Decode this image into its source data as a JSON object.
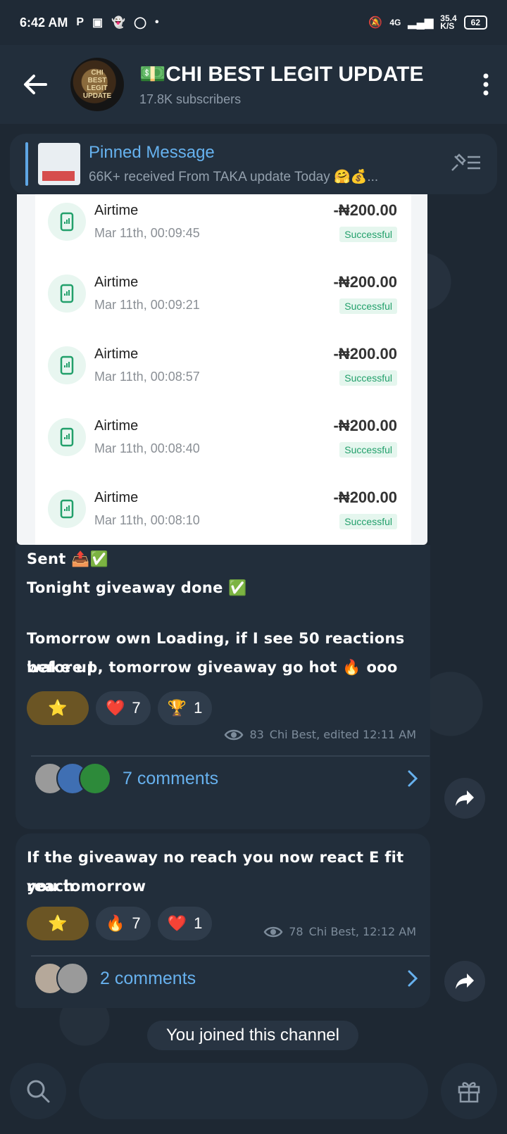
{
  "status_bar": {
    "time": "6:42 AM",
    "notif_icons": [
      "P",
      "screenshot-icon",
      "snapchat-icon",
      "whatsapp-icon",
      "dot-icon"
    ],
    "net": "4G",
    "speed": "35.4",
    "speed_unit": "K/S",
    "battery": "62"
  },
  "header": {
    "title": "💵CHI BEST LEGIT UPDATE",
    "subscribers": "17.8K subscribers",
    "avatar_text": "CHI BEST LEGIT UPDATE"
  },
  "pinned": {
    "title": "Pinned Message",
    "body": "66K+ received From TAKA update Today 🤗💰..."
  },
  "transactions": [
    {
      "name": "Airtime",
      "date": "Mar 11th, 00:09:45",
      "amount": "-₦200.00",
      "status": "Successful"
    },
    {
      "name": "Airtime",
      "date": "Mar 11th, 00:09:21",
      "amount": "-₦200.00",
      "status": "Successful"
    },
    {
      "name": "Airtime",
      "date": "Mar 11th, 00:08:57",
      "amount": "-₦200.00",
      "status": "Successful"
    },
    {
      "name": "Airtime",
      "date": "Mar 11th, 00:08:40",
      "amount": "-₦200.00",
      "status": "Successful"
    },
    {
      "name": "Airtime",
      "date": "Mar 11th, 00:08:10",
      "amount": "-₦200.00",
      "status": "Successful"
    }
  ],
  "message1": {
    "line1": "Sent 📤✅",
    "line2": "Tonight giveaway done ✅",
    "line3": "Tomorrow own Loading, if I see 50 reactions before I",
    "line4": "wake up, tomorrow giveaway go hot 🔥 ooo",
    "reactions": [
      {
        "emoji": "⭐",
        "count": ""
      },
      {
        "emoji": "❤️",
        "count": "7"
      },
      {
        "emoji": "🏆",
        "count": "1"
      }
    ],
    "views": "83",
    "meta": "Chi Best, edited 12:11 AM",
    "comments": "7 comments"
  },
  "message2": {
    "line1": "If the giveaway no reach you now react E fit reach",
    "line2": "you tomorrow",
    "reactions": [
      {
        "emoji": "⭐",
        "count": ""
      },
      {
        "emoji": "🔥",
        "count": "7"
      },
      {
        "emoji": "❤️",
        "count": "1"
      }
    ],
    "views": "78",
    "meta": "Chi Best, 12:12 AM",
    "comments": "2 comments"
  },
  "joined_notice": "You joined this channel",
  "colors": {
    "accent": "#66b2ef",
    "success": "#22a06b",
    "bubble": "#222e3b"
  }
}
